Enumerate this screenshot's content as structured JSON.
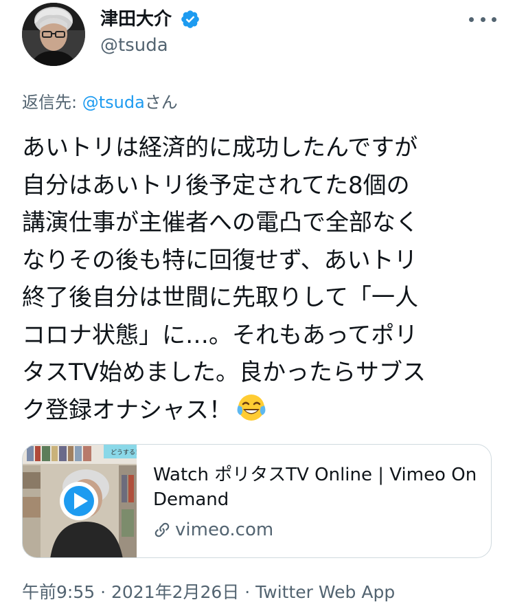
{
  "user": {
    "display_name": "津田大介",
    "handle": "@tsuda",
    "verified": true
  },
  "reply_to": {
    "prefix": "返信先: ",
    "mention": "@tsuda",
    "suffix": "さん"
  },
  "tweet": {
    "text": "あいトリは経済的に成功したんですが\n自分はあいトリ後予定されてた8個の\n講演仕事が主催者への電凸で全部なく\nなりその後も特に回復せず、あいトリ\n終了後自分は世間に先取りして「一人\nコロナ状態」に…。それもあってポリ\nタスTV始めました。良かったらサブス\nク登録オナシャス！",
    "emoji": "face-with-tears-of-joy"
  },
  "card": {
    "title": "Watch ポリタスTV Online | Vimeo On Demand",
    "domain": "vimeo.com",
    "thumb_caption": "どうする！?と"
  },
  "meta": {
    "text": "午前9:55 · 2021年2月26日 · Twitter Web App"
  },
  "colors": {
    "accent": "#1d9bf0",
    "secondary_text": "#536471",
    "border": "#cfd9de"
  }
}
